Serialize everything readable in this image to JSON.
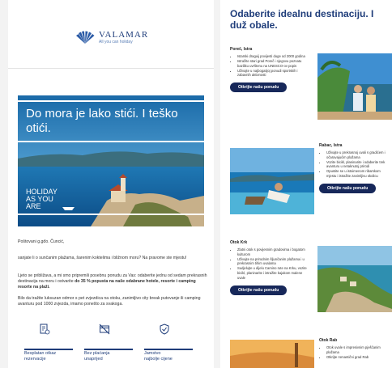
{
  "brand": {
    "name": "VALAMAR",
    "tagline": "All you can holiday"
  },
  "hero": {
    "title": "Do mora je lako stići. I teško otići.",
    "subtitle_1": "HOLIDAY",
    "subtitle_2": "AS YOU",
    "subtitle_3": "ARE"
  },
  "letter": {
    "greeting": "Poštovani g.gđo. Čuncić,",
    "p1": "sanjate li o sunčanim plažama, šarenim koktelima i bližnom moru? Na pravome ste mjestu!",
    "p2_a": "Ljeto se približava, a mi smo pripremili posebnu ponudu za Vas: odaberite jednu od sedam prekrasnih destinacija na moru i ostvarite ",
    "p2_b": "do 35 % popusta na naše odabrane hotele, resorte i camping resorte na plaži.",
    "p3": "Bilo da tražite luksuzan odmor s pet zvjezdica na otoku, zanimljivo city break putovanje ili camping avanturu pod 1000 zvjezda, imamo ponešto za svakoga."
  },
  "benefits": [
    {
      "label_1": "Besplatan otkaz",
      "label_2": "rezervacije",
      "icon": "document-check-icon"
    },
    {
      "label_1": "Bez plaćanja",
      "label_2": "unaprijed",
      "icon": "no-card-icon"
    },
    {
      "label_1": "Jamstvo",
      "label_2": "najbolje cijene",
      "icon": "shield-check-icon"
    }
  ],
  "right": {
    "title": "Odaberite idealnu destinaciju. I duž obale.",
    "button_label": "Otkrijte našu ponudu",
    "destinations": [
      {
        "name": "Poreč, Istra",
        "bullets": [
          "Istarski draguij povijesti duge od 2000 godina",
          "Istražite stari grad Poreč i njegovu poznatu baziliku uvrštenu na UNESCO-ov popis",
          "Uživajte u najbogatijoj ponudi sportskih i zabavnih aktivnosti"
        ]
      },
      {
        "name": "Rabac, Istra",
        "bullets": [
          "Uživajte u prekrasnoj uvali s gradićem i očaravajućim plažama",
          "Vozite bicikl, planinarite i odaberite trek avanturu u netaknutoj prirodi",
          "Opustite se u istoimenom ribarskom mjestu i istražite zanimljivu okolicu"
        ]
      },
      {
        "name": "Otok Krk",
        "bullets": [
          "Zlatni otok s povijesnim gradovima i bogatom kulturom",
          "Uživajte na prirodnim šljunčanim plažama i u prekrasnim tihim uvalama",
          "Sudjelujte u dijelu Camino rute na Krku, vozite bicikl, planinarite i istražite kajakom malene uvale"
        ]
      },
      {
        "name": "Otok Rab",
        "bullets": [
          "Otok uvale s impresivnim pješčanim plažama",
          "Otkrijte romantični grad Rab"
        ]
      }
    ]
  }
}
